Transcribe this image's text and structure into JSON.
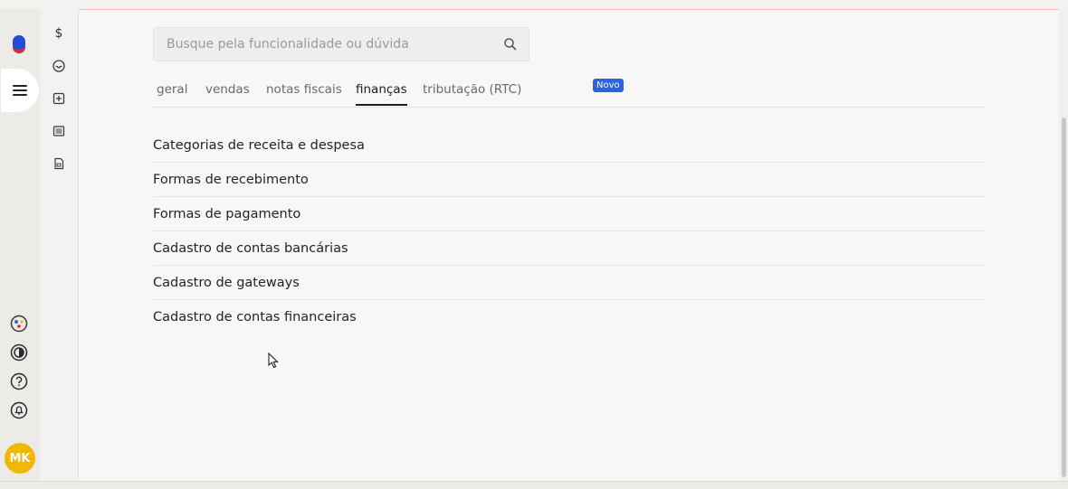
{
  "search": {
    "placeholder": "Busque pela funcionalidade ou dúvida",
    "icon": "search-icon"
  },
  "tabs": [
    {
      "label": "geral",
      "active": false
    },
    {
      "label": "vendas",
      "active": false
    },
    {
      "label": "notas fiscais",
      "active": false
    },
    {
      "label": "finanças",
      "active": true
    },
    {
      "label": "tributação (RTC)",
      "active": false,
      "badge": "Novo"
    }
  ],
  "finance_items": [
    "Categorias de receita e despesa",
    "Formas de recebimento",
    "Formas de pagamento",
    "Cadastro de contas bancárias",
    "Cadastro de gateways",
    "Cadastro de contas financeiras"
  ],
  "rail": {
    "avatar_initials": "MK",
    "icons": [
      "app-logo-icon",
      "menu-icon",
      "integrations-icon",
      "contrast-icon",
      "help-icon",
      "notifications-icon"
    ]
  },
  "subnav": {
    "icons": [
      "dollar-icon",
      "inbox-icon",
      "add-box-icon",
      "list-icon",
      "document-icon"
    ],
    "dollar_glyph": "$"
  },
  "colors": {
    "accent": "#2d63e2",
    "avatar": "#f2b705",
    "text": "#242424"
  }
}
